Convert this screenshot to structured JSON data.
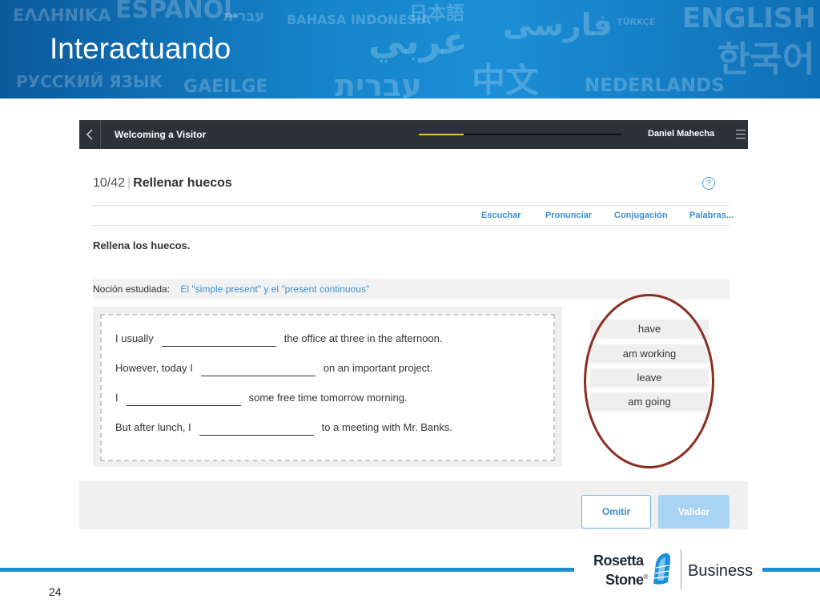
{
  "slide": {
    "title": "Interactuando",
    "page_number": "24",
    "background_words": [
      "ΕΛΛΗΝΙΚΑ",
      "ESPAÑOL",
      "עברית",
      "BAHASA INDONESIA",
      "日本語",
      "فارسی",
      "TÜRKÇE",
      "ENGLISH",
      "عربي",
      "한국어",
      "РУССКИЙ ЯЗЫК",
      "GAEILGE",
      "עברית",
      "中文",
      "NEDERLANDS"
    ],
    "colors": {
      "banner": "#1583c9",
      "accent": "#1b8fd6",
      "circle": "#8b2e22"
    }
  },
  "app": {
    "topbar": {
      "back_icon": "chevron-left-icon",
      "lesson_title": "Welcoming a Visitor",
      "progress": 0.22,
      "user_name": "Daniel Mahecha",
      "menu_icon": "hamburger-menu-icon"
    },
    "exercise": {
      "counter": "10/42",
      "separator": "|",
      "title": "Rellenar huecos",
      "help_icon": "help-circle-icon",
      "help_glyph": "?",
      "tools": [
        "Escuchar",
        "Pronunciar",
        "Conjugación",
        "Palabras..."
      ],
      "instruction": "Rellena los huecos.",
      "notion_label": "Noción estudiada:",
      "notion_value": "El \"simple present\" y el \"present continuous\"",
      "sentences": [
        {
          "before": "I usually",
          "after": "the office at three in the afternoon."
        },
        {
          "before": "However, today I",
          "after": "on an important project."
        },
        {
          "before": "I",
          "after": "some free time tomorrow morning."
        },
        {
          "before": "But after lunch, I",
          "after": "to a meeting with Mr. Banks."
        }
      ],
      "options": [
        "have",
        "am working",
        "leave",
        "am going"
      ]
    },
    "footer": {
      "skip_label": "Omitir",
      "validate_label": "Validar"
    }
  },
  "logo": {
    "line1": "Rosetta",
    "line2": "Stone",
    "registered": "®",
    "business": "Business"
  }
}
